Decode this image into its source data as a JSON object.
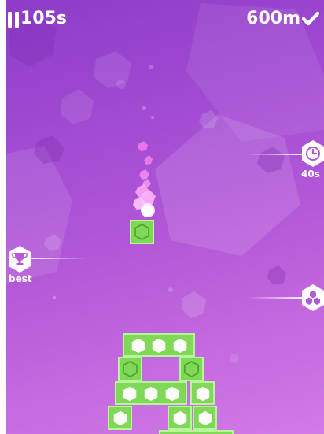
{
  "hud": {
    "timer": "105s",
    "distance": "600m"
  },
  "markers": {
    "time_bonus_label": "40s",
    "best_label": "best"
  },
  "icons": {
    "pause": "pause-icon",
    "check": "check-icon",
    "clock": "clock-icon",
    "trophy": "trophy-icon",
    "hex_cluster": "hex-cluster-icon"
  },
  "colors": {
    "background_top": "#8d3cc9",
    "background_bottom": "#d27ae6",
    "block_green": "#7fd957",
    "block_border": "#b7f59a",
    "text": "#ffffff"
  }
}
